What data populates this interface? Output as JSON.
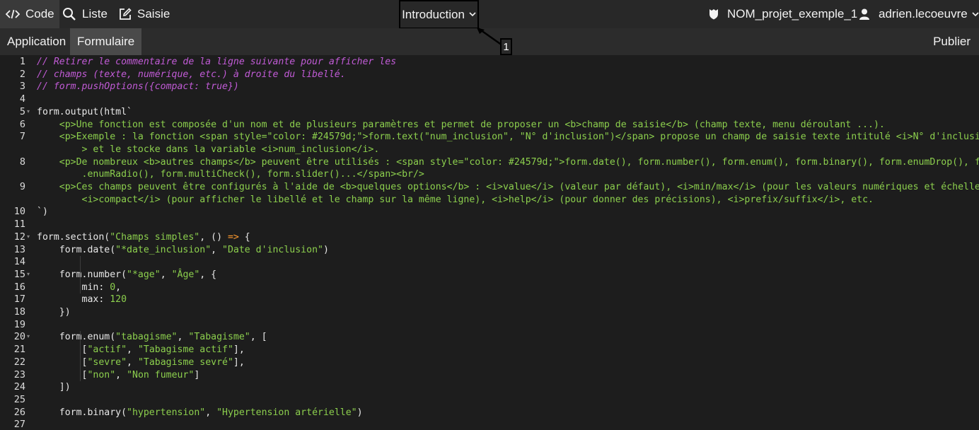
{
  "topbar": {
    "code_label": "Code",
    "liste_label": "Liste",
    "saisie_label": "Saisie",
    "page_select": "Introduction",
    "project_name": "NOM_projet_exemple_1",
    "user_name": "adrien.lecoeuvre"
  },
  "annotation": {
    "label": "1"
  },
  "subbar": {
    "tab_application": "Application",
    "tab_formulaire": "Formulaire",
    "publish_label": "Publier"
  },
  "editor": {
    "line_numbers": [
      "1",
      "2",
      "3",
      "4",
      "5",
      "6",
      "7",
      "8",
      "9",
      "10",
      "11",
      "12",
      "13",
      "14",
      "15",
      "16",
      "17",
      "18",
      "19",
      "20",
      "21",
      "22",
      "23",
      "24",
      "25",
      "26",
      "27"
    ],
    "lines": [
      [
        [
          "cmt",
          "// Retirer le commentaire de la ligne suivante pour afficher les"
        ]
      ],
      [
        [
          "cmt",
          "// champs (texte, numérique, etc.) à droite du libellé."
        ]
      ],
      [
        [
          "cmt",
          "// form.pushOptions({compact: true})"
        ]
      ],
      [],
      [
        [
          "pl",
          "form.output(html`"
        ]
      ],
      [
        [
          "str",
          "    <p>Une fonction est composée d'un nom et de plusieurs paramètres et permet de proposer un <b>champ de saisie</b> (champ texte, menu déroulant ...)."
        ]
      ],
      [
        [
          "str",
          "    <p>Exemple : la fonction <span style=\"color: #24579d;\">form.text(\"num_inclusion\", \"N° d'inclusion\")</span> propose un champ de saisie texte intitulé <i>N° d'inclusion</i"
        ]
      ],
      [
        [
          "str",
          "        > et le stocke dans la variable <i>num_inclusion</i>."
        ]
      ],
      [
        [
          "str",
          "    <p>De nombreux <b>autres champs</b> peuvent être utilisés : <span style=\"color: #24579d;\">form.date(), form.number(), form.enum(), form.binary(), form.enumDrop(), form"
        ]
      ],
      [
        [
          "str",
          "        .enumRadio(), form.multiCheck(), form.slider()...</span><br/>"
        ]
      ],
      [
        [
          "str",
          "    <p>Ces champs peuvent être configurés à l'aide de <b>quelques options</b> : <i>value</i> (valeur par défaut), <i>min/max</i> (pour les valeurs numériques et échelles),"
        ]
      ],
      [
        [
          "str",
          "        <i>compact</i> (pour afficher le libellé et le champ sur la même ligne), <i>help</i> (pour donner des précisions), <i>prefix/suffix</i>, etc."
        ]
      ],
      [
        [
          "pl",
          "`)"
        ]
      ],
      [],
      [
        [
          "pl",
          "form.section("
        ],
        [
          "str",
          "\"Champs simples\""
        ],
        [
          "pl",
          ", () "
        ],
        [
          "kw",
          "=>"
        ],
        [
          "pl",
          " {"
        ]
      ],
      [
        [
          "pl",
          "    form.date("
        ],
        [
          "str",
          "\"*date_inclusion\""
        ],
        [
          "pl",
          ", "
        ],
        [
          "str",
          "\"Date d'inclusion\""
        ],
        [
          "pl",
          ")"
        ]
      ],
      [],
      [
        [
          "pl",
          "    form.number("
        ],
        [
          "str",
          "\"*age\""
        ],
        [
          "pl",
          ", "
        ],
        [
          "str",
          "\"Âge\""
        ],
        [
          "pl",
          ", {"
        ]
      ],
      [
        [
          "pl",
          "        min: "
        ],
        [
          "num",
          "0"
        ],
        [
          "pl",
          ","
        ]
      ],
      [
        [
          "pl",
          "        max: "
        ],
        [
          "num",
          "120"
        ]
      ],
      [
        [
          "pl",
          "    })"
        ]
      ],
      [],
      [
        [
          "pl",
          "    form.enum("
        ],
        [
          "str",
          "\"tabagisme\""
        ],
        [
          "pl",
          ", "
        ],
        [
          "str",
          "\"Tabagisme\""
        ],
        [
          "pl",
          ", ["
        ]
      ],
      [
        [
          "pl",
          "        ["
        ],
        [
          "str",
          "\"actif\""
        ],
        [
          "pl",
          ", "
        ],
        [
          "str",
          "\"Tabagisme actif\""
        ],
        [
          "pl",
          "],"
        ]
      ],
      [
        [
          "pl",
          "        ["
        ],
        [
          "str",
          "\"sevre\""
        ],
        [
          "pl",
          ", "
        ],
        [
          "str",
          "\"Tabagisme sevré\""
        ],
        [
          "pl",
          "],"
        ]
      ],
      [
        [
          "pl",
          "        ["
        ],
        [
          "str",
          "\"non\""
        ],
        [
          "pl",
          ", "
        ],
        [
          "str",
          "\"Non fumeur\""
        ],
        [
          "pl",
          "]"
        ]
      ],
      [
        [
          "pl",
          "    ])"
        ]
      ],
      [],
      [
        [
          "pl",
          "    form.binary("
        ],
        [
          "str",
          "\"hypertension\""
        ],
        [
          "pl",
          ", "
        ],
        [
          "str",
          "\"Hypertension artérielle\""
        ],
        [
          "pl",
          ")"
        ]
      ],
      []
    ]
  },
  "colors": {
    "comment": "#c15bd6",
    "string": "#8ccf4d",
    "keyword": "#ff9a2e",
    "plain": "#e8e8e8",
    "background": "#1d1d1d"
  }
}
